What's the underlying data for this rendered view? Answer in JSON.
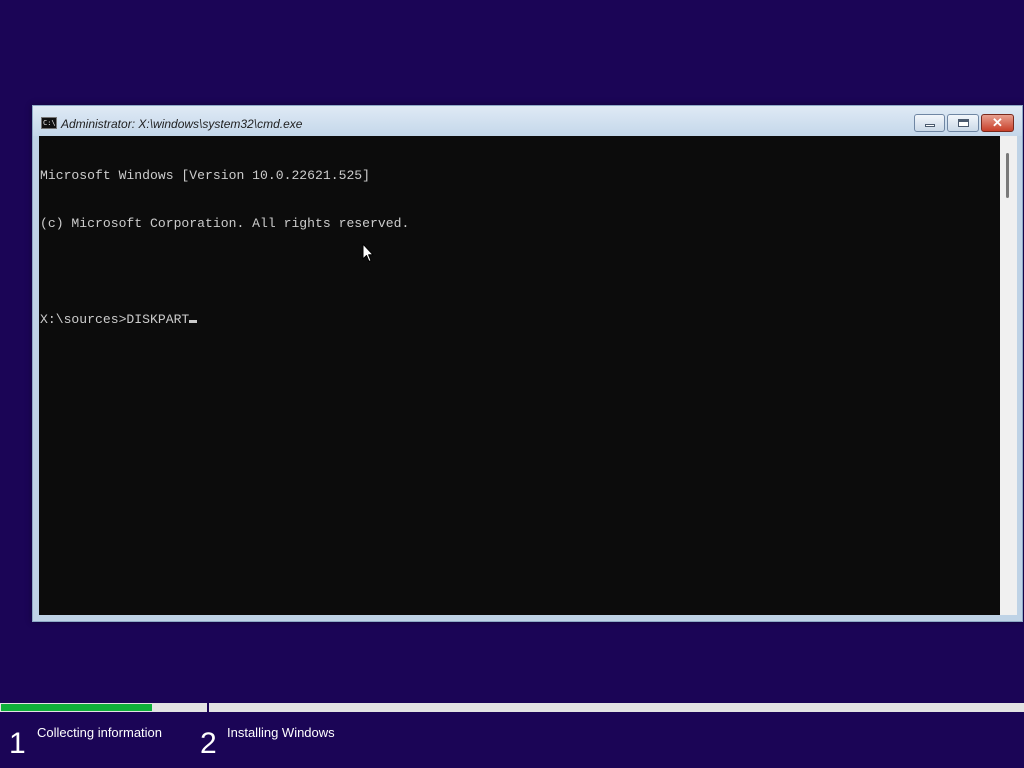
{
  "window": {
    "title": "Administrator: X:\\windows\\system32\\cmd.exe",
    "icon": "cmd-icon",
    "icon_text": "C:\\",
    "minimize_icon": "minimize-icon",
    "maximize_icon": "maximize-icon",
    "close_icon": "close-icon",
    "close_glyph": "✕"
  },
  "console": {
    "lines": [
      "Microsoft Windows [Version 10.0.22621.525]",
      "(c) Microsoft Corporation. All rights reserved.",
      "",
      "X:\\sources>DISKPART"
    ]
  },
  "setup": {
    "progress_fraction": 0.147,
    "progress_color": "#0fb03a",
    "background_color": "#1b0556",
    "steps": [
      {
        "number": "1",
        "label": "Collecting information"
      },
      {
        "number": "2",
        "label": "Installing Windows"
      }
    ]
  }
}
